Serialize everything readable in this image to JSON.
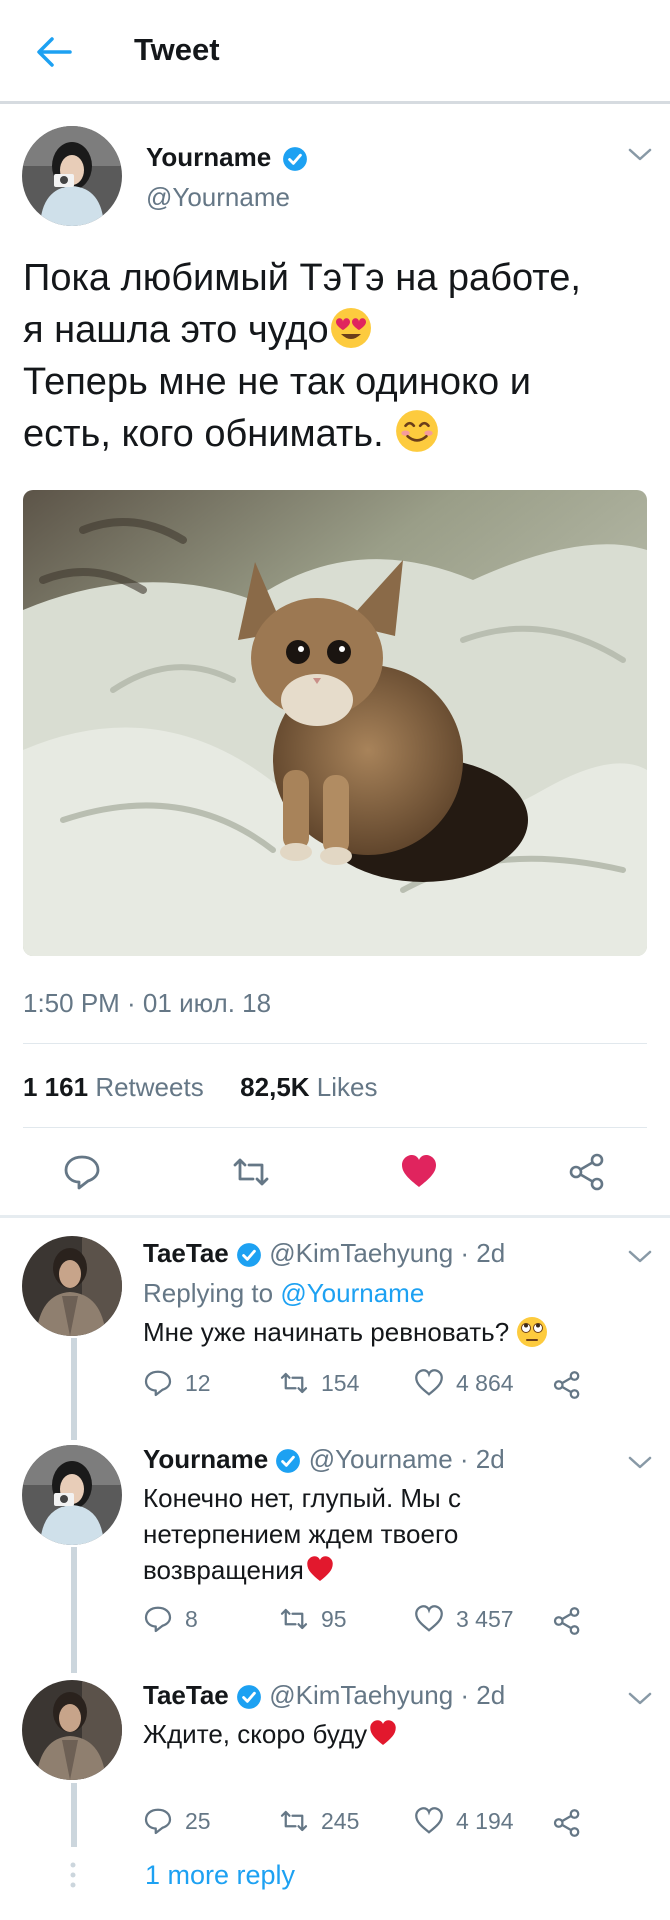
{
  "header": {
    "title": "Tweet"
  },
  "tweet": {
    "author_name": "Yourname",
    "author_handle": "@Yourname",
    "text_line1": "Пока любимый ТэТэ на работе,",
    "text_line2": "я нашла это чудо",
    "text_line3": "Теперь мне не так одиноко и",
    "text_line4": "есть, кого обнимать.",
    "time": "1:50 PM · 01 июл. 18",
    "retweets_count": "1 161",
    "retweets_label": "Retweets",
    "likes_count": "82,5K",
    "likes_label": "Likes"
  },
  "replies": [
    {
      "name": "TaeTae",
      "handle": "@KimTaehyung · 2d",
      "replying_label": "Replying to",
      "replying_handle": "@Yourname",
      "text": "Мне уже начинать ревновать?",
      "stats": {
        "replies": "12",
        "retweets": "154",
        "likes": "4 864"
      }
    },
    {
      "name": "Yourname",
      "handle": "@Yourname · 2d",
      "text_line1": "Конечно нет, глупый. Мы с",
      "text_line2": "нетерпением ждем твоего",
      "text_line3": "возвращения",
      "stats": {
        "replies": "8",
        "retweets": "95",
        "likes": "3 457"
      }
    },
    {
      "name": "TaeTae",
      "handle": "@KimTaehyung · 2d",
      "text": "Ждите, скоро буду",
      "stats": {
        "replies": "25",
        "retweets": "245",
        "likes": "4 194"
      }
    }
  ],
  "more_reply": "1 more reply",
  "colors": {
    "accent": "#1da1f2",
    "like": "#e0245e",
    "verified": "#1da1f2",
    "heart_emoji": "#e2182d"
  }
}
